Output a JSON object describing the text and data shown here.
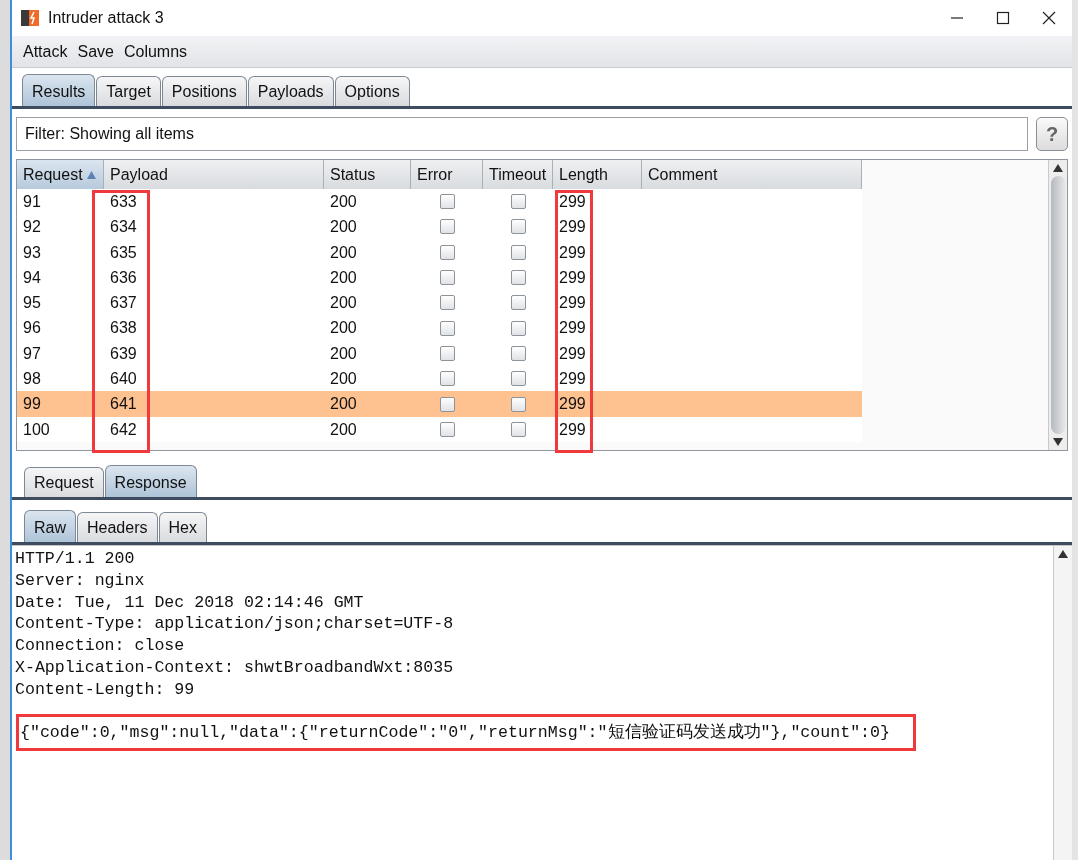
{
  "window": {
    "title": "Intruder attack 3"
  },
  "menu": [
    "Attack",
    "Save",
    "Columns"
  ],
  "tabs": [
    {
      "label": "Results",
      "selected": true
    },
    {
      "label": "Target",
      "selected": false
    },
    {
      "label": "Positions",
      "selected": false
    },
    {
      "label": "Payloads",
      "selected": false
    },
    {
      "label": "Options",
      "selected": false
    }
  ],
  "filter": {
    "value": "Filter: Showing all items",
    "help": "?"
  },
  "table": {
    "columns": [
      {
        "label": "Request",
        "sorted": true
      },
      {
        "label": "Payload",
        "sorted": false,
        "annotated": true
      },
      {
        "label": "Status",
        "sorted": false
      },
      {
        "label": "Error",
        "sorted": false
      },
      {
        "label": "Timeout",
        "sorted": false
      },
      {
        "label": "Length",
        "sorted": false,
        "annotated": true
      },
      {
        "label": "Comment",
        "sorted": false
      }
    ],
    "rows": [
      {
        "request": "91",
        "payload": "633",
        "status": "200",
        "error": false,
        "timeout": false,
        "length": "299",
        "selected": false
      },
      {
        "request": "92",
        "payload": "634",
        "status": "200",
        "error": false,
        "timeout": false,
        "length": "299",
        "selected": false
      },
      {
        "request": "93",
        "payload": "635",
        "status": "200",
        "error": false,
        "timeout": false,
        "length": "299",
        "selected": false
      },
      {
        "request": "94",
        "payload": "636",
        "status": "200",
        "error": false,
        "timeout": false,
        "length": "299",
        "selected": false
      },
      {
        "request": "95",
        "payload": "637",
        "status": "200",
        "error": false,
        "timeout": false,
        "length": "299",
        "selected": false
      },
      {
        "request": "96",
        "payload": "638",
        "status": "200",
        "error": false,
        "timeout": false,
        "length": "299",
        "selected": false
      },
      {
        "request": "97",
        "payload": "639",
        "status": "200",
        "error": false,
        "timeout": false,
        "length": "299",
        "selected": false
      },
      {
        "request": "98",
        "payload": "640",
        "status": "200",
        "error": false,
        "timeout": false,
        "length": "299",
        "selected": false
      },
      {
        "request": "99",
        "payload": "641",
        "status": "200",
        "error": false,
        "timeout": false,
        "length": "299",
        "selected": true
      },
      {
        "request": "100",
        "payload": "642",
        "status": "200",
        "error": false,
        "timeout": false,
        "length": "299",
        "selected": false
      }
    ]
  },
  "message_tabs": [
    {
      "label": "Request",
      "selected": false
    },
    {
      "label": "Response",
      "selected": true
    }
  ],
  "view_tabs": [
    {
      "label": "Raw",
      "selected": true
    },
    {
      "label": "Headers",
      "selected": false
    },
    {
      "label": "Hex",
      "selected": false
    }
  ],
  "response": {
    "lines": [
      "HTTP/1.1 200",
      "Server: nginx",
      "Date: Tue, 11 Dec 2018 02:14:46 GMT",
      "Content-Type: application/json;charset=UTF-8",
      "Connection: close",
      "X-Application-Context: shwtBroadbandWxt:8035",
      "Content-Length: 99"
    ],
    "body": {
      "text": "{\"code\":0,\"msg\":null,\"data\":{\"returnCode\":\"0\",\"returnMsg\":\"短信验证码发送成功\"},\"count\":0}",
      "annotated": true
    }
  }
}
